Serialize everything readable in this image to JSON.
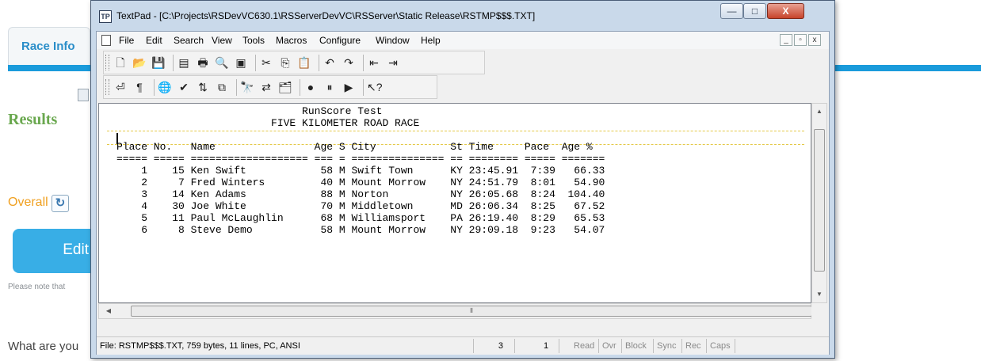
{
  "background_page": {
    "tab_label": "Race Info",
    "results_heading": "Results",
    "overall_label": "Overall",
    "overall_button_icon": "refresh-icon",
    "edit_button_label": "Edit",
    "note_text": "Please note that",
    "question_text": "What are you"
  },
  "window": {
    "title": "TextPad - [C:\\Projects\\RSDevVC630.1\\RSServerDevVC\\RSServer\\Static Release\\RSTMP$$$.TXT]",
    "minimize": "—",
    "maximize": "□",
    "close": "X"
  },
  "menu": {
    "items": [
      "File",
      "Edit",
      "Search",
      "View",
      "Tools",
      "Macros",
      "Configure",
      "Window",
      "Help"
    ],
    "mdi_buttons": [
      "_",
      "▫",
      "x"
    ]
  },
  "toolbar": {
    "row1": [
      {
        "name": "new-file-icon",
        "glyph": "🗋"
      },
      {
        "name": "open-folder-icon",
        "glyph": "📂"
      },
      {
        "name": "save-icon",
        "glyph": "💾"
      },
      {
        "name": "sep"
      },
      {
        "name": "manage-files-icon",
        "glyph": "▤"
      },
      {
        "name": "print-icon",
        "glyph": "🖶"
      },
      {
        "name": "print-preview-icon",
        "glyph": "🔍"
      },
      {
        "name": "document-properties-icon",
        "glyph": "▣"
      },
      {
        "name": "sep"
      },
      {
        "name": "cut-icon",
        "glyph": "✂"
      },
      {
        "name": "copy-icon",
        "glyph": "⎘"
      },
      {
        "name": "paste-icon",
        "glyph": "📋"
      },
      {
        "name": "sep"
      },
      {
        "name": "undo-icon",
        "glyph": "↶"
      },
      {
        "name": "redo-icon",
        "glyph": "↷"
      },
      {
        "name": "sep"
      },
      {
        "name": "indent-icon",
        "glyph": "⇤"
      },
      {
        "name": "outdent-icon",
        "glyph": "⇥"
      }
    ],
    "row2": [
      {
        "name": "word-wrap-icon",
        "glyph": "⏎"
      },
      {
        "name": "show-paragraph-icon",
        "glyph": "¶"
      },
      {
        "name": "sep"
      },
      {
        "name": "web-browser-icon",
        "glyph": "🌐"
      },
      {
        "name": "spelling-icon",
        "glyph": "✔"
      },
      {
        "name": "sort-icon",
        "glyph": "⇅"
      },
      {
        "name": "compare-icon",
        "glyph": "⧉"
      },
      {
        "name": "sep"
      },
      {
        "name": "find-icon",
        "glyph": "🔭"
      },
      {
        "name": "replace-icon",
        "glyph": "⇄"
      },
      {
        "name": "find-in-files-icon",
        "glyph": "🗂"
      },
      {
        "name": "sep"
      },
      {
        "name": "record-macro-icon",
        "glyph": "●"
      },
      {
        "name": "pause-macro-icon",
        "glyph": "⏸"
      },
      {
        "name": "play-macro-icon",
        "glyph": "▶"
      },
      {
        "name": "sep"
      },
      {
        "name": "context-help-icon",
        "glyph": "↖?"
      }
    ]
  },
  "document": {
    "lines": [
      "                              RunScore Test",
      "                         FIVE KILOMETER ROAD RACE",
      "",
      "Place No.   Name                Age S City            St Time     Pace  Age %",
      "===== ===== =================== === = =============== == ======== ===== =======",
      "    1    15 Ken Swift            58 M Swift Town      KY 23:45.91  7:39   66.33",
      "    2     7 Fred Winters         40 M Mount Morrow    NY 24:51.79  8:01   54.90",
      "    3    14 Ken Adams            88 M Norton          NY 26:05.68  8:24  104.40",
      "    4    30 Joe White            70 M Middletown      MD 26:06.34  8:25   67.52",
      "    5    11 Paul McLaughlin      68 M Williamsport    PA 26:19.40  8:29   65.53",
      "    6     8 Steve Demo           58 M Mount Morrow    NY 29:09.18  9:23   54.07"
    ]
  },
  "statusbar": {
    "file_info": "File: RSTMP$$$.TXT, 759 bytes, 11 lines, PC, ANSI",
    "line": "3",
    "column": "1",
    "flags": [
      "Read",
      "Ovr",
      "Block",
      "Sync",
      "Rec",
      "Caps"
    ]
  }
}
